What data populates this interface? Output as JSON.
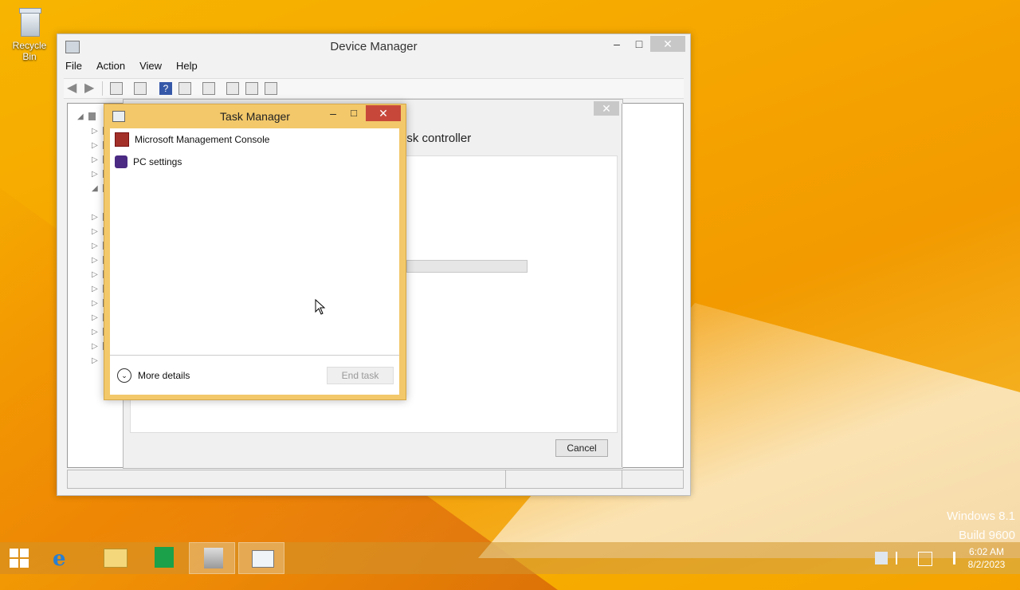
{
  "desktop": {
    "recycle_bin_label": "Recycle Bin",
    "watermark": {
      "line1": "Windows 8.1",
      "line2": "Build 9600"
    }
  },
  "device_manager": {
    "title": "Device Manager",
    "menu": [
      "File",
      "Action",
      "View",
      "Help"
    ],
    "controls": {
      "minimize": "–",
      "maximize": "□",
      "close": "✕"
    }
  },
  "properties_dialog": {
    "heading_partial": "isk controller",
    "cancel_label": "Cancel",
    "close": "✕"
  },
  "task_manager": {
    "title": "Task Manager",
    "controls": {
      "minimize": "–",
      "maximize": "□",
      "close": "✕"
    },
    "apps": [
      {
        "name": "Microsoft Management Console",
        "icon": "mmc-icon"
      },
      {
        "name": "PC settings",
        "icon": "pc-settings-icon"
      }
    ],
    "more_details_label": "More details",
    "end_task_label": "End task"
  },
  "taskbar": {
    "items": [
      "start",
      "internet-explorer",
      "file-explorer",
      "store",
      "device-manager",
      "task-manager"
    ],
    "active": [
      "device-manager",
      "task-manager"
    ],
    "clock": {
      "time": "6:02 AM",
      "date": "8/2/2023"
    }
  }
}
